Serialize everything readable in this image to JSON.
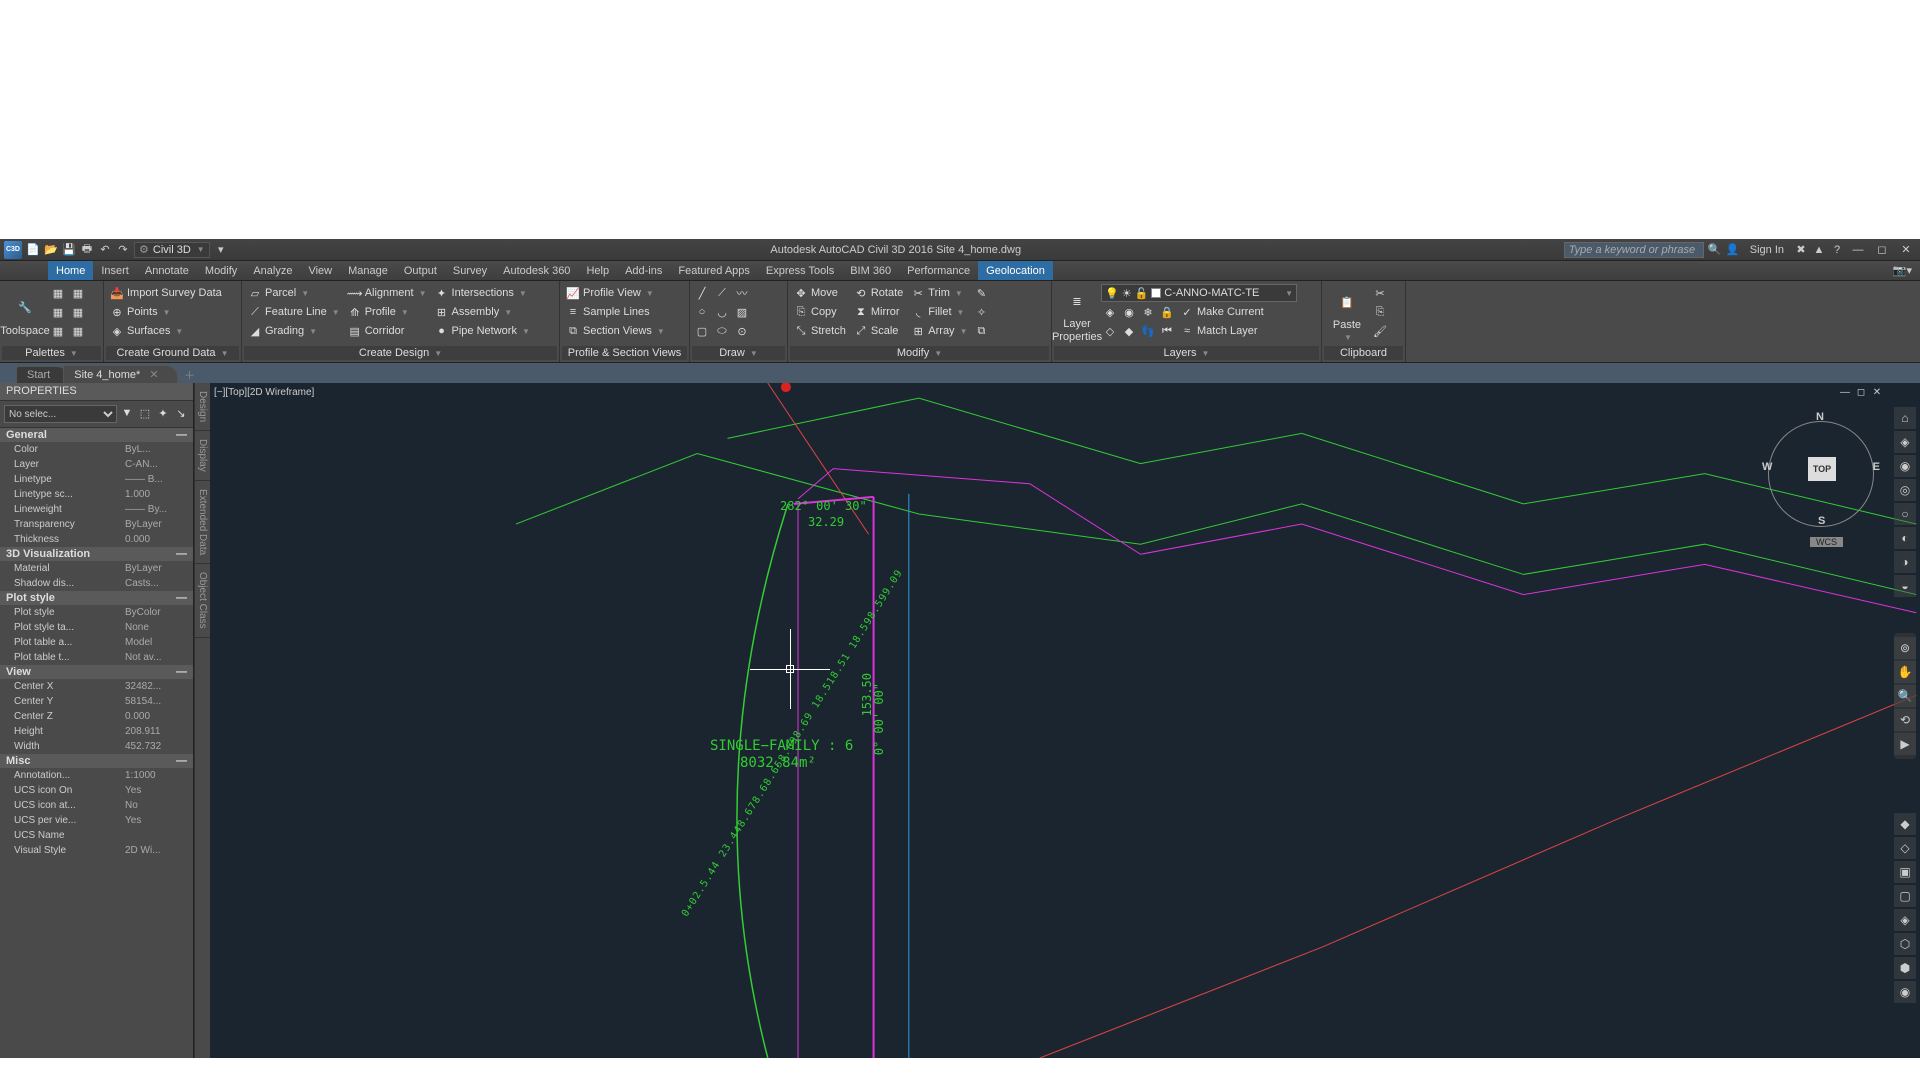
{
  "title": "Autodesk AutoCAD Civil 3D 2016    Site 4_home.dwg",
  "workspace": "Civil 3D",
  "search_placeholder": "Type a keyword or phrase",
  "signin": "Sign In",
  "menus": [
    "Home",
    "Insert",
    "Annotate",
    "Modify",
    "Analyze",
    "View",
    "Manage",
    "Output",
    "Survey",
    "Autodesk 360",
    "Help",
    "Add-ins",
    "Featured Apps",
    "Express Tools",
    "BIM 360",
    "Performance",
    "Geolocation"
  ],
  "active_menu": "Home",
  "hl_menu": "Geolocation",
  "ribbon": {
    "palettes": {
      "toolspace": "Toolspace",
      "title": "Palettes"
    },
    "ground": {
      "import": "Import Survey Data",
      "points": "Points",
      "surfaces": "Surfaces",
      "title": "Create Ground Data"
    },
    "design": {
      "parcel": "Parcel",
      "featureline": "Feature Line",
      "grading": "Grading",
      "alignment": "Alignment",
      "profile": "Profile",
      "corridor": "Corridor",
      "intersections": "Intersections",
      "assembly": "Assembly",
      "pipenet": "Pipe Network",
      "title": "Create Design"
    },
    "profile": {
      "pview": "Profile View",
      "slines": "Sample Lines",
      "sviews": "Section Views",
      "title": "Profile & Section Views"
    },
    "draw": {
      "title": "Draw"
    },
    "modify": {
      "move": "Move",
      "copy": "Copy",
      "stretch": "Stretch",
      "rotate": "Rotate",
      "mirror": "Mirror",
      "scale": "Scale",
      "trim": "Trim",
      "fillet": "Fillet",
      "array": "Array",
      "title": "Modify"
    },
    "layers": {
      "props": "Layer Properties",
      "current": "C-ANNO-MATC-TE",
      "make": "Make Current",
      "match": "Match Layer",
      "title": "Layers"
    },
    "clip": {
      "paste": "Paste",
      "title": "Clipboard"
    }
  },
  "doctabs": {
    "start": "Start",
    "file": "Site 4_home*"
  },
  "properties": {
    "title": "PROPERTIES",
    "selector": "No selec...",
    "groups": [
      {
        "name": "General",
        "rows": [
          [
            "Color",
            "ByL..."
          ],
          [
            "Layer",
            "C-AN..."
          ],
          [
            "Linetype",
            "—— B..."
          ],
          [
            "Linetype sc...",
            "1.000"
          ],
          [
            "Lineweight",
            "—— By..."
          ],
          [
            "Transparency",
            "ByLayer"
          ],
          [
            "Thickness",
            "0.000"
          ]
        ]
      },
      {
        "name": "3D Visualization",
        "rows": [
          [
            "Material",
            "ByLayer"
          ],
          [
            "Shadow dis...",
            "Casts..."
          ]
        ]
      },
      {
        "name": "Plot style",
        "rows": [
          [
            "Plot style",
            "ByColor"
          ],
          [
            "Plot style ta...",
            "None"
          ],
          [
            "Plot table a...",
            "Model"
          ],
          [
            "Plot table t...",
            "Not av..."
          ]
        ]
      },
      {
        "name": "View",
        "rows": [
          [
            "Center X",
            "32482..."
          ],
          [
            "Center Y",
            "58154..."
          ],
          [
            "Center Z",
            "0.000"
          ],
          [
            "Height",
            "208.911"
          ],
          [
            "Width",
            "452.732"
          ]
        ]
      },
      {
        "name": "Misc",
        "rows": [
          [
            "Annotation...",
            "1:1000"
          ],
          [
            "UCS icon On",
            "Yes"
          ],
          [
            "UCS icon at...",
            "No"
          ],
          [
            "UCS per vie...",
            "Yes"
          ],
          [
            "UCS Name",
            ""
          ],
          [
            "Visual Style",
            "2D Wi..."
          ]
        ]
      }
    ]
  },
  "sidetabs": [
    "Design",
    "Display",
    "Extended Data",
    "Object Class"
  ],
  "canvas": {
    "label": "[−][Top][2D Wireframe]",
    "cube_face": "TOP",
    "wcs": "WCS",
    "bearing": "282° 00' 30\"",
    "dist1": "32.29",
    "dist2": "153.50",
    "bearing2": "0° 00' 00\"",
    "parcel_name": "SINGLE−FAMILY  :  6",
    "parcel_area": "8032.84m²",
    "curve_text": "0+02.5.44 23.448.678.68.658.698.69 18.518.51 18.598.599.09"
  }
}
